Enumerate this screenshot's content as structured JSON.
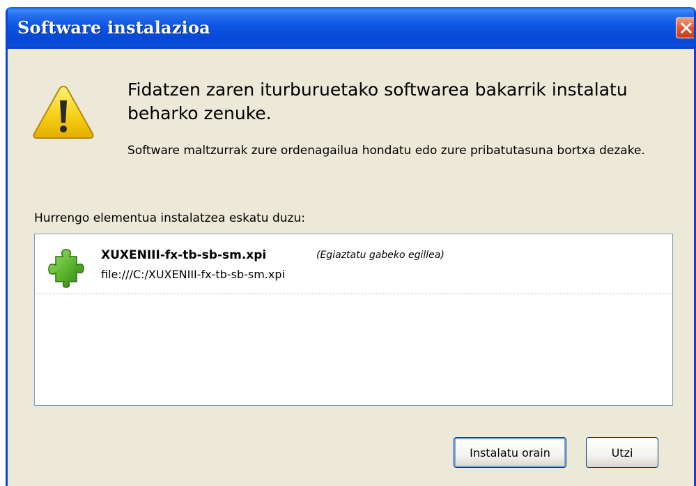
{
  "window": {
    "title": "Software instalazioa"
  },
  "warning": {
    "headline": "Fidatzen zaren iturburuetako softwarea bakarrik instalatu beharko zenuke.",
    "description": "Software maltzurrak zure ordenagailua hondatu edo zure pribatutasuna bortxa dezake."
  },
  "list": {
    "label": "Hurrengo elementua instalatzea eskatu duzu:",
    "items": [
      {
        "name": "XUXENIII-fx-tb-sb-sm.xpi",
        "note": "(Egiaztatu gabeko egillea)",
        "url": "file:///C:/XUXENIII-fx-tb-sb-sm.xpi",
        "icon": "puzzle-piece-icon"
      }
    ]
  },
  "buttons": {
    "install_label": "Instalatu orain",
    "cancel_label": "Utzi"
  },
  "colors": {
    "titlebar": "#0a4fdb",
    "dialog_bg": "#ece9d8",
    "close_button": "#e2572f",
    "warning_icon": "#f7d117",
    "puzzle_icon": "#5cb82e"
  }
}
